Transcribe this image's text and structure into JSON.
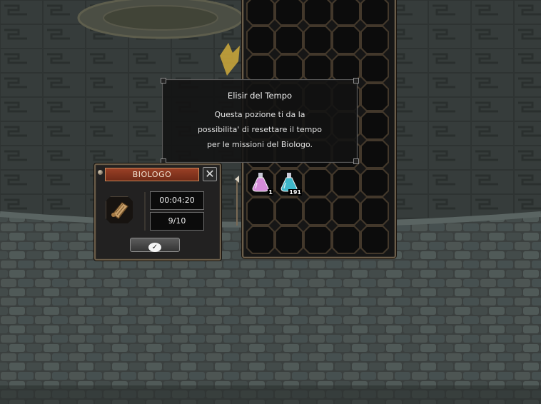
{
  "tooltip": {
    "title": "Elisir del Tempo",
    "lines": [
      "Questa pozione ti da la",
      "possibilita' di resettare il tempo",
      "per le missioni del Biologo."
    ]
  },
  "biologo": {
    "title": "BIOLOGO",
    "close_icon": "close-icon",
    "item_icon": "research-scroll-icon",
    "timer": "00:04:20",
    "count": "9/10",
    "confirm_icon": "checkmark-icon"
  },
  "inventory": {
    "columns": 5,
    "rows": 9,
    "items": [
      {
        "slot": 30,
        "icon": "pink-potion-icon",
        "count": "1",
        "color": "#d58cd8"
      },
      {
        "slot": 31,
        "icon": "cyan-potion-icon",
        "count": "191",
        "color": "#3fb7c9"
      }
    ]
  },
  "colors": {
    "frame": "#6b5d49",
    "title_bar": "#8a3520"
  }
}
